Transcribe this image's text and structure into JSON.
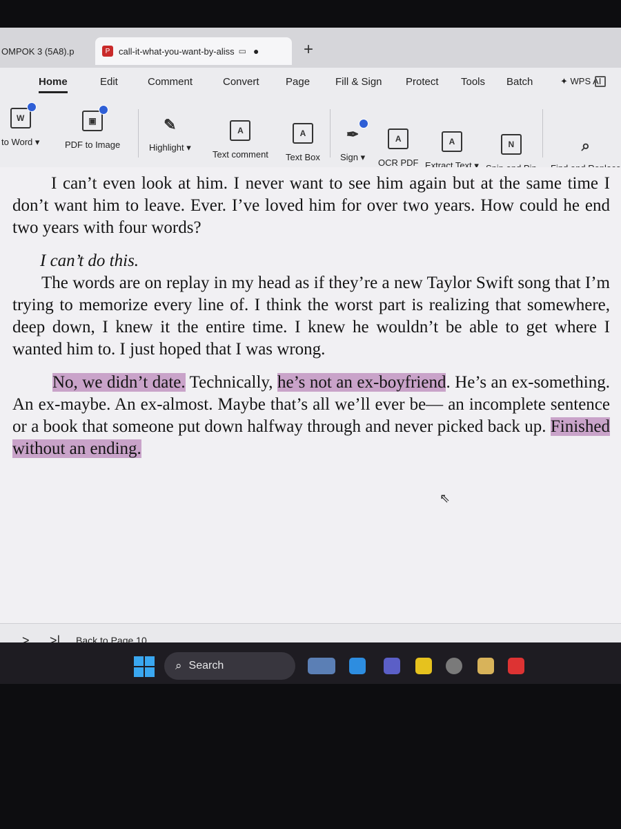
{
  "tabs": {
    "inactive_label": "OMPOK 3 (5A8).p",
    "active_label": "call-it-what-you-want-by-aliss",
    "new_tab": "+"
  },
  "menu": {
    "items": [
      "Home",
      "Edit",
      "Comment",
      "Convert",
      "Page",
      "Fill & Sign",
      "Protect",
      "Tools",
      "Batch",
      "WPS AI"
    ]
  },
  "toolbar": {
    "to_word": "to Word",
    "pdf_to_image": "PDF to Image",
    "highlight": "Highlight",
    "text_comment": "Text comment",
    "text_box": "Text Box",
    "sign": "Sign",
    "ocr_pdf": "OCR PDF",
    "extract_text": "Extract Text",
    "snip_and_pin": "Snip and Pin",
    "find_and_replace": "Find and Replace",
    "caret": "▾"
  },
  "document": {
    "p1": "I can’t even look at him. I never want to see him again but at the same time I don’t want him to leave. Ever. I’ve loved him for over two years. How could he end two years with four words?",
    "p2": "I can’t do this.",
    "p3": "The words are on replay in my head as if they’re a new Taylor Swift song that I’m trying to memorize every line of. I think the worst part is realizing that somewhere, deep down, I knew it the entire time. I knew he wouldn’t be able to get where I wanted him to. I just hoped that I was wrong.",
    "p4_hl1": "No, we didn’t date.",
    "p4_t1": " Technically, ",
    "p4_hl2": "he’s not an ex-boyfriend",
    "p4_t2": ". He’s an ex-something. An ex-maybe. An ex-almost. Maybe that’s all we’ll ever be— an incomplete sentence or a book that someone put down halfway through and never picked back up. ",
    "p4_hl3": "Finished without an ending."
  },
  "highlight_color": "#c9a3c9",
  "statusbar": {
    "next": ">",
    "last": ">|",
    "back_to_page": "Back to Page 10"
  },
  "taskbar": {
    "search_label": "Search"
  }
}
